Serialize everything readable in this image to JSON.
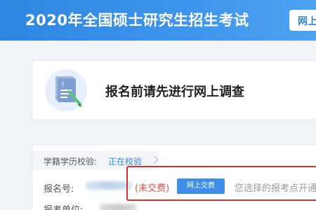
{
  "header": {
    "title": "2020年全国硕士研究生招生考试",
    "tab_label": "网上报名"
  },
  "notice": {
    "text": "报名前请先进行网上调查",
    "icon": "survey-document-icon"
  },
  "info": {
    "verify_label": "学籍学历校验:",
    "verify_status": "正在校验",
    "regno_label": "报名号:",
    "fee_status": "(未交费)",
    "pay_button": "网上交费",
    "site_notice": "您选择的报考点开通",
    "unit_label": "报考单位:"
  },
  "colors": {
    "header_blue": "#2f86e0",
    "link_blue": "#2f86e0",
    "unpaid_red": "#d9534f",
    "highlight_red": "#d2332b"
  }
}
